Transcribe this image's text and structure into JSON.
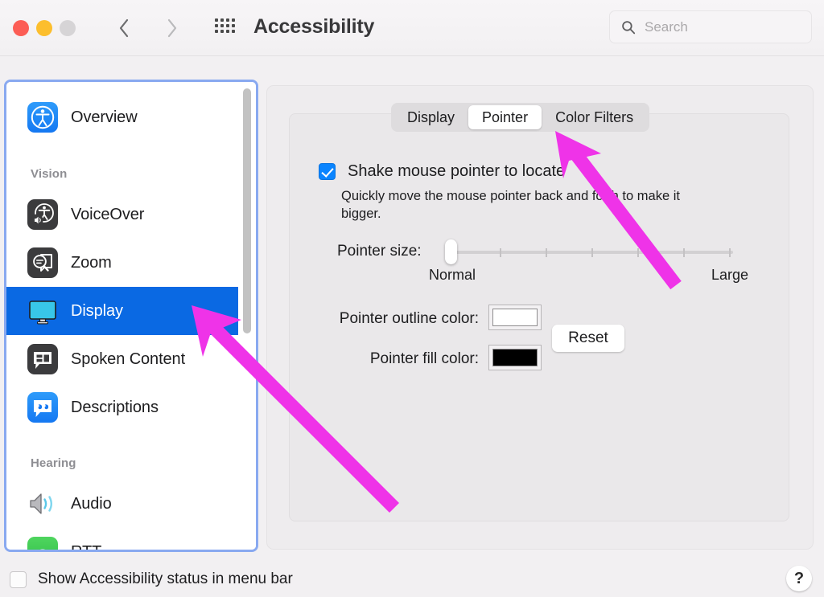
{
  "window": {
    "title": "Accessibility",
    "traffic_lights": [
      "close",
      "minimize",
      "zoom-disabled"
    ],
    "nav": {
      "back": "back-chevron",
      "forward": "forward-chevron",
      "grid": "show-all-grid"
    },
    "search": {
      "placeholder": "Search",
      "value": "",
      "icon": "search-icon"
    }
  },
  "sidebar": {
    "scrollbar": {
      "visible": true
    },
    "items": [
      {
        "label": "Overview",
        "icon": "accessibility-icon",
        "selected": false,
        "section": null
      },
      {
        "label": "VoiceOver",
        "icon": "voiceover-icon",
        "selected": false,
        "section": "Vision"
      },
      {
        "label": "Zoom",
        "icon": "zoom-icon",
        "selected": false,
        "section": "Vision"
      },
      {
        "label": "Display",
        "icon": "display-monitor-icon",
        "selected": true,
        "section": "Vision"
      },
      {
        "label": "Spoken Content",
        "icon": "spoken-content-icon",
        "selected": false,
        "section": "Vision"
      },
      {
        "label": "Descriptions",
        "icon": "descriptions-icon",
        "selected": false,
        "section": "Vision"
      },
      {
        "label": "Audio",
        "icon": "audio-speaker-icon",
        "selected": false,
        "section": "Hearing"
      },
      {
        "label": "RTT",
        "icon": "rtt-phone-icon",
        "selected": false,
        "section": "Hearing"
      }
    ],
    "sections": [
      {
        "label": "Vision"
      },
      {
        "label": "Hearing"
      }
    ]
  },
  "main": {
    "tabs": [
      {
        "label": "Display",
        "selected": false
      },
      {
        "label": "Pointer",
        "selected": true
      },
      {
        "label": "Color Filters",
        "selected": false
      }
    ],
    "shake_pointer": {
      "label": "Shake mouse pointer to locate",
      "checked": true,
      "description": "Quickly move the mouse pointer back and forth to make it bigger."
    },
    "pointer_size": {
      "label": "Pointer size:",
      "min_label": "Normal",
      "max_label": "Large",
      "value": 0,
      "ticks": 6
    },
    "pointer_outline": {
      "label": "Pointer outline color:",
      "color": "#ffffff"
    },
    "pointer_fill": {
      "label": "Pointer fill color:",
      "color": "#000000"
    },
    "reset_button": "Reset"
  },
  "footer": {
    "menu_bar_checkbox": {
      "label": "Show Accessibility status in menu bar",
      "checked": false
    },
    "help_button": "?"
  },
  "annotations": {
    "arrow_color": "#ef33e8",
    "arrows": [
      {
        "name": "arrow-to-pointer-tab",
        "target": "Pointer"
      },
      {
        "name": "arrow-to-display-sidebar-item",
        "target": "Display"
      }
    ]
  },
  "colors": {
    "selection_blue": "#0a69e3",
    "focus_ring": "#89a9f0",
    "checkbox_blue": "#0a84ff",
    "window_bg": "#f2f0f2"
  }
}
